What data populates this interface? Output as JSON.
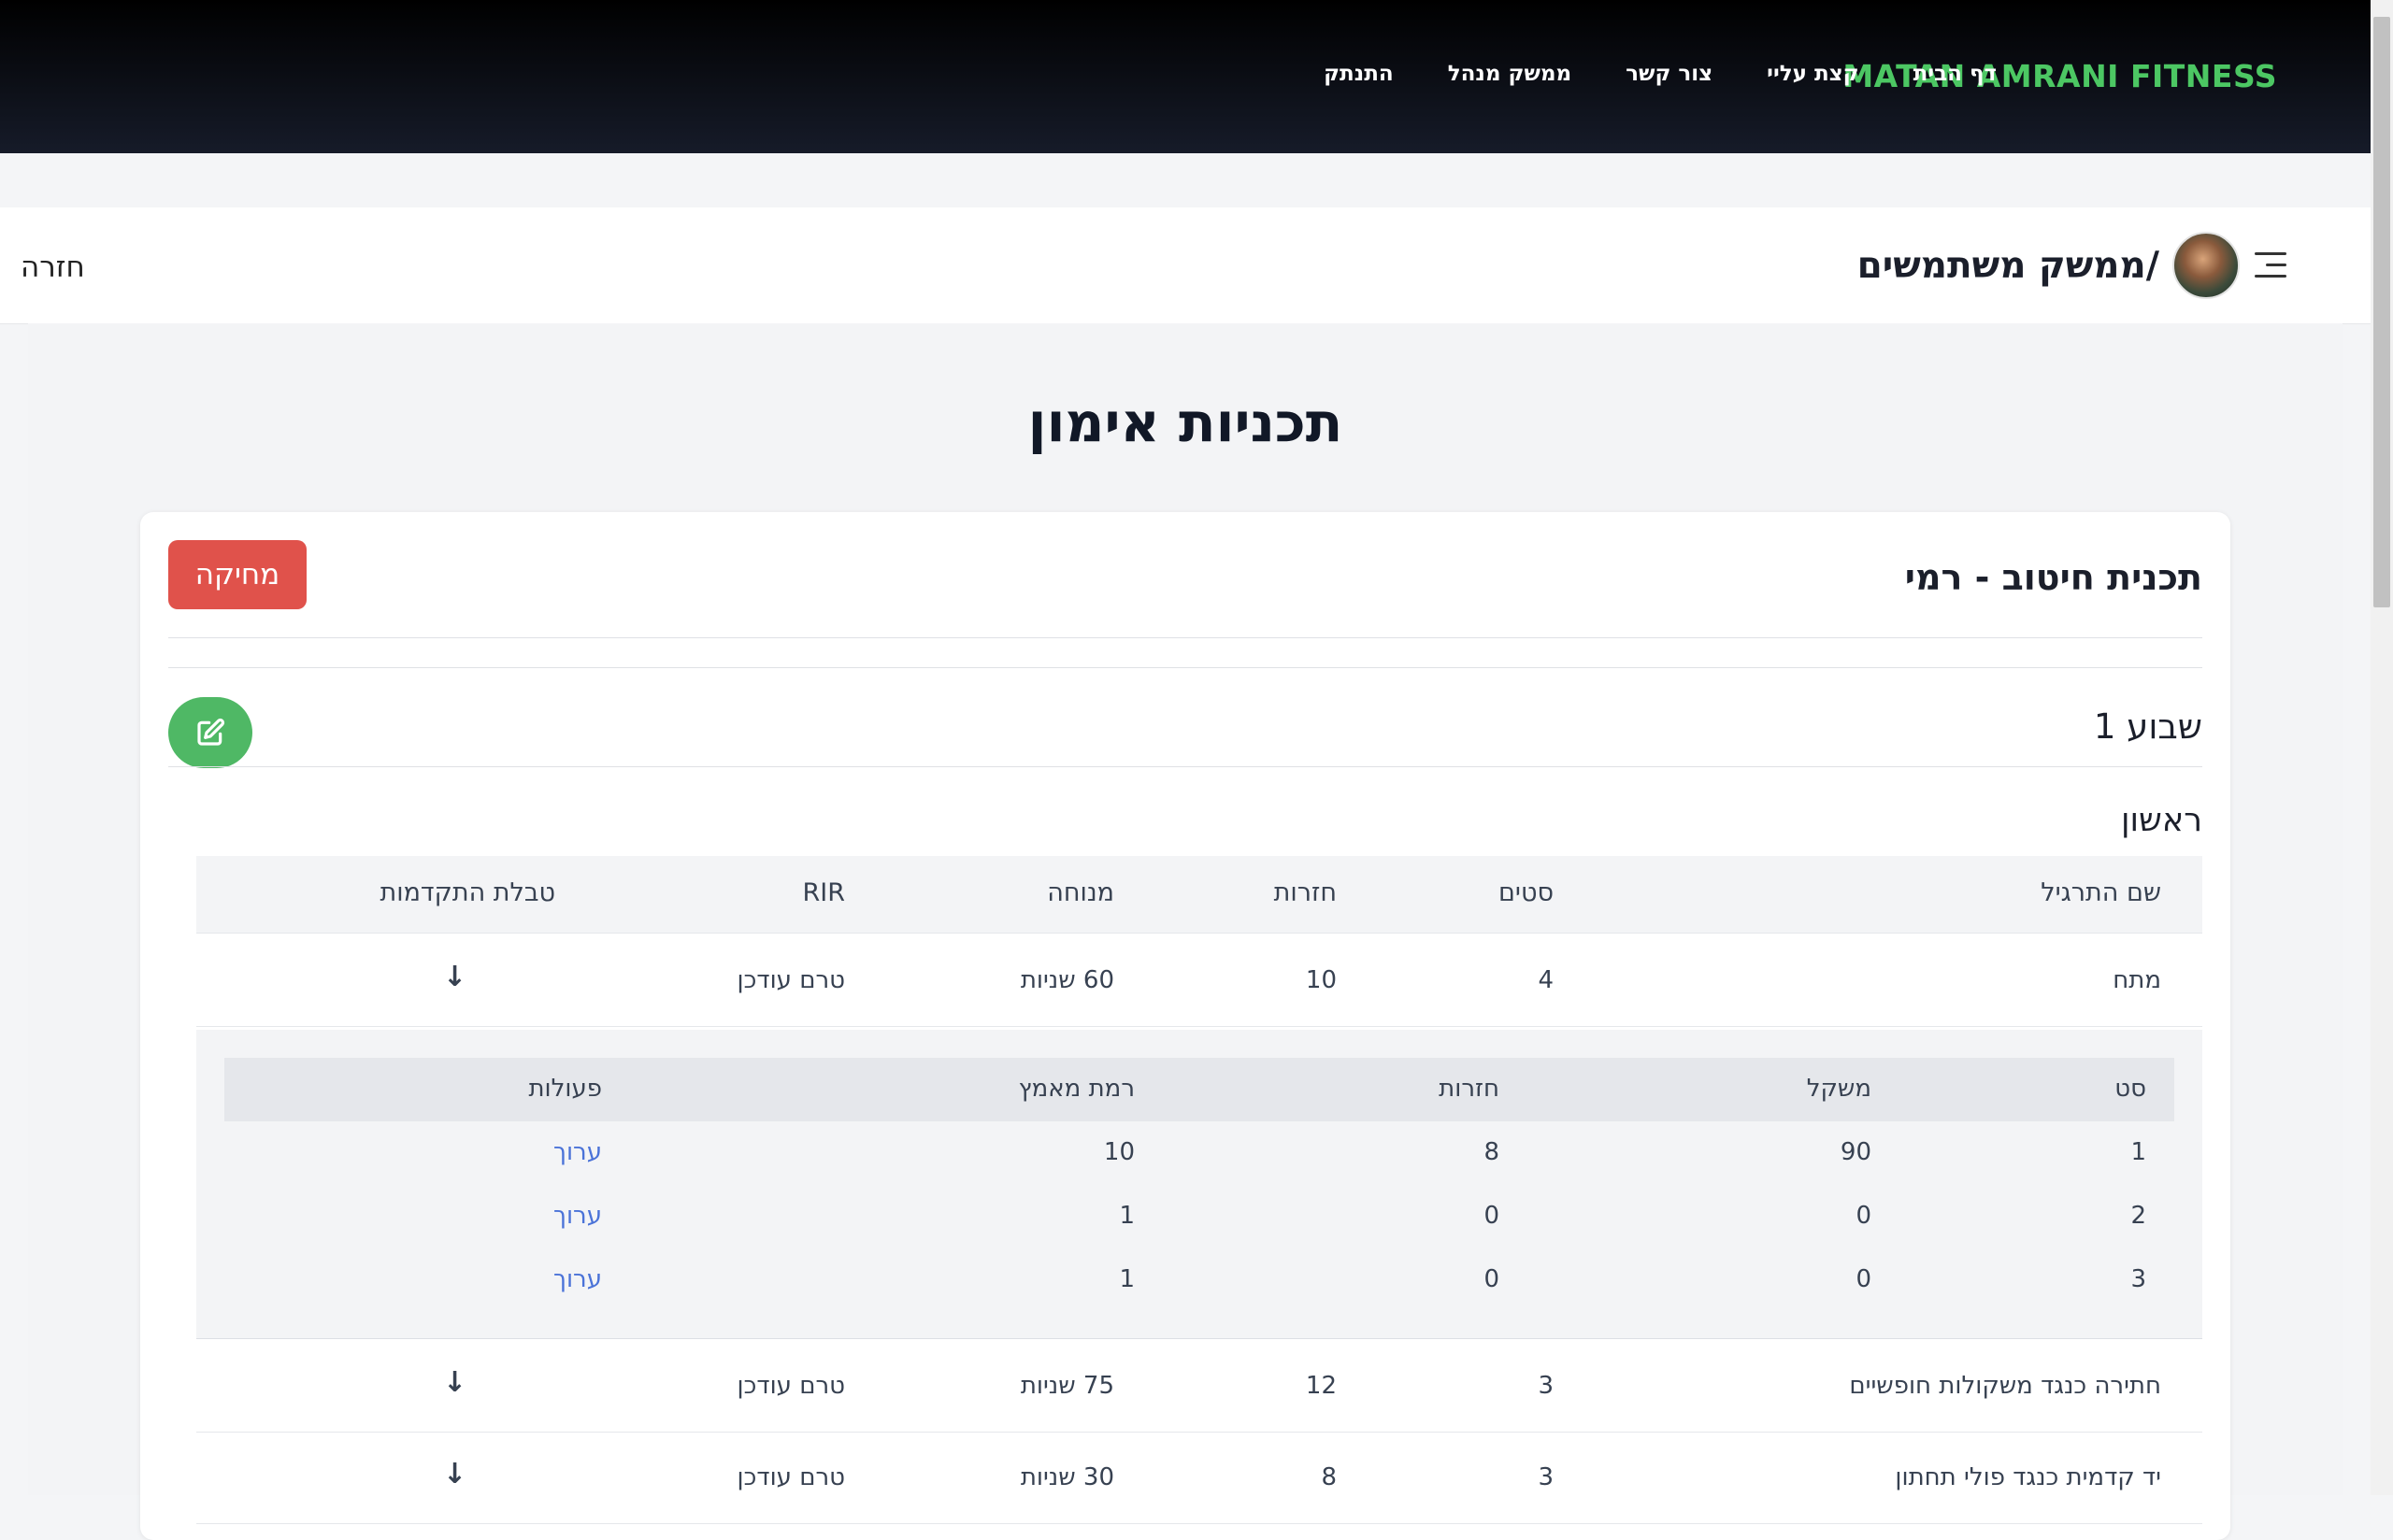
{
  "nav": {
    "brand": "MATAN AMRANI FITNESS",
    "links": [
      "דף הבית",
      "קצת עליי",
      "צור קשר",
      "ממשק מנהל",
      "התנתק"
    ]
  },
  "admin_header": {
    "title": "ממשק משתמשים/",
    "back": "חזרה"
  },
  "page": {
    "title": "תכניות אימון"
  },
  "plan": {
    "name": "תכנית חיטוב - רמי",
    "delete_label": "מחיקה",
    "week_title": "שבוע 1",
    "day_title": "ראשון"
  },
  "table": {
    "headers": {
      "exercise": "שם התרגיל",
      "sets": "סטים",
      "reps": "חזרות",
      "rest": "מנוחה",
      "rir": "RIR",
      "progress": "טבלת התקדמות"
    },
    "rows": [
      {
        "exercise": "מתח",
        "sets": "4",
        "reps": "10",
        "rest": "60 שניות",
        "rir": "טרם עודכן",
        "progress": "↓"
      },
      {
        "exercise": "חתירה כנגד משקולות חופשיים",
        "sets": "3",
        "reps": "12",
        "rest": "75 שניות",
        "rir": "טרם עודכן",
        "progress": "↓"
      },
      {
        "exercise": "יד קדמית כנגד פולי תחתון",
        "sets": "3",
        "reps": "8",
        "rest": "30 שניות",
        "rir": "טרם עודכן",
        "progress": "↓"
      }
    ]
  },
  "sets_table": {
    "headers": {
      "set": "סט",
      "weight": "משקל",
      "reps": "חזרות",
      "effort": "רמת מאמץ",
      "actions": "פעולות"
    },
    "rows": [
      {
        "set": "1",
        "weight": "90",
        "reps": "8",
        "effort": "10",
        "action": "ערוך"
      },
      {
        "set": "2",
        "weight": "0",
        "reps": "0",
        "effort": "1",
        "action": "ערוך"
      },
      {
        "set": "3",
        "weight": "0",
        "reps": "0",
        "effort": "1",
        "action": "ערוך"
      }
    ]
  },
  "icons": {
    "menu": "hamburger-menu-icon",
    "edit": "pencil-square-icon",
    "expand": "arrow-down-icon"
  },
  "colors": {
    "brand": "#4cc763",
    "delete": "#e0524b",
    "edit_button": "#4fb865",
    "link": "#4b73d8",
    "arrow": "#43b35a"
  }
}
